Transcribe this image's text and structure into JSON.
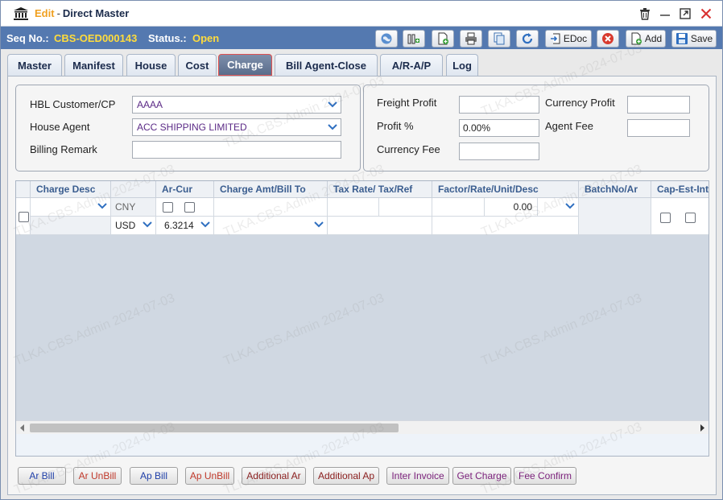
{
  "window": {
    "mode": "Edit",
    "separator": "-",
    "name": "Direct Master"
  },
  "status_bar": {
    "seq_label": "Seq No.:",
    "seq_value": "CBS-OED000143",
    "status_label": "Status.:",
    "status_value": "Open"
  },
  "toolbar": {
    "edoc_label": "EDoc",
    "add_label": "Add",
    "save_label": "Save"
  },
  "tabs": [
    {
      "label": "Master"
    },
    {
      "label": "Manifest"
    },
    {
      "label": "House"
    },
    {
      "label": "Cost"
    },
    {
      "label": "Charge",
      "active": true
    },
    {
      "label": "Bill Agent-Close"
    },
    {
      "label": "A/R-A/P"
    },
    {
      "label": "Log"
    }
  ],
  "form": {
    "hbl_customer_label": "HBL Customer/CP",
    "hbl_customer_value": "AAAA",
    "house_agent_label": "House Agent",
    "house_agent_value": "ACC SHIPPING LIMITED",
    "billing_remark_label": "Billing Remark",
    "billing_remark_value": "",
    "freight_profit_label": "Freight Profit",
    "freight_profit_value": "",
    "profit_pct_label": "Profit %",
    "profit_pct_value": "0.00%",
    "currency_fee_label": "Currency Fee",
    "currency_fee_value": "",
    "currency_profit_label": "Currency Profit",
    "currency_profit_value": "",
    "agent_fee_label": "Agent Fee",
    "agent_fee_value": ""
  },
  "grid": {
    "headers": [
      "Charge Desc",
      "Ar-Cur",
      "Charge Amt/Bill To",
      "Tax Rate/ Tax/Ref",
      "Factor/Rate/Unit/Desc",
      "BatchNo/Ar",
      "Cap-Est-Int"
    ],
    "row": {
      "currency_top": "CNY",
      "currency_bottom": "USD",
      "ex_rate": "6.3214",
      "factor_amount": "0.00"
    }
  },
  "bottom_buttons": [
    {
      "label": "Ar Bill",
      "color": "#1f3fa8"
    },
    {
      "label": "Ar UnBill",
      "color": "#c0392b"
    },
    {
      "label": "Ap Bill",
      "color": "#1f3fa8"
    },
    {
      "label": "Ap UnBill",
      "color": "#c0392b"
    },
    {
      "label": "Additional Ar",
      "color": "#8a1d1d"
    },
    {
      "label": "Additional Ap",
      "color": "#8a1d1d"
    },
    {
      "label": "Inter Invoice",
      "color": "#7a1f7a"
    },
    {
      "label": "Get Charge",
      "color": "#7a1f7a"
    },
    {
      "label": "Fee Confirm",
      "color": "#7a1f7a"
    }
  ],
  "watermark": "TLKA.CBS.Admin 2024-07-03",
  "icons": [
    "bank-icon",
    "trash-icon",
    "minimize-icon",
    "maximize-icon",
    "close-icon",
    "globe-icon",
    "columns-icon",
    "new-doc-icon",
    "print-icon",
    "copy-icon",
    "refresh-icon",
    "edoc-icon",
    "cancel-icon",
    "add-icon",
    "save-icon",
    "chevron-down-icon"
  ],
  "colors": {
    "status_bar": "#5479b0",
    "highlight_text": "#ffdc3c",
    "active_tab": "#5a6d8c",
    "grid_header_text": "#3a5d8f"
  }
}
